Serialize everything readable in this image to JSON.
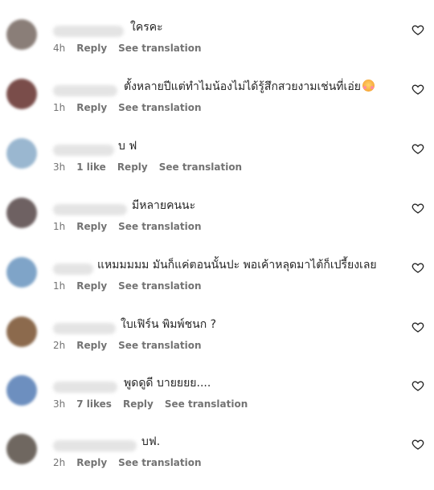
{
  "icons": {
    "like": "heart-outline-icon"
  },
  "comments": [
    {
      "text": "ใครคะ",
      "time": "4h",
      "likes": "",
      "reply": "Reply",
      "translate": "See translation",
      "avatar_color": "#8a7e78"
    },
    {
      "text": "ตั้งหลายปีแต่ทำไมน้องไม่ได้รู้สึกสวยงามเช่นที่เอ่ย",
      "emoji": "smiling-face-with-hearts",
      "time": "1h",
      "likes": "",
      "reply": "Reply",
      "translate": "See translation",
      "avatar_color": "#7a4d4a"
    },
    {
      "text": "บ ฟ",
      "time": "3h",
      "likes": "1 like",
      "reply": "Reply",
      "translate": "See translation",
      "avatar_color": "#9ab7d0"
    },
    {
      "text": "มีหลายคนนะ",
      "time": "1h",
      "likes": "",
      "reply": "Reply",
      "translate": "See translation",
      "avatar_color": "#6e6162"
    },
    {
      "text": "แหมมมมม มันก็แค่ตอนนั้นปะ พอเค้าหลุดมาไต้ก็เปรี้ยงเลย",
      "time": "1h",
      "likes": "",
      "reply": "Reply",
      "translate": "See translation",
      "avatar_color": "#7fa4c8"
    },
    {
      "text": "ใบเฟิร์น พิมพ์ชนก ?",
      "time": "2h",
      "likes": "",
      "reply": "Reply",
      "translate": "See translation",
      "avatar_color": "#8c6a4d"
    },
    {
      "text": "พูดดูดี บายยยย....",
      "time": "3h",
      "likes": "7 likes",
      "reply": "Reply",
      "translate": "See translation",
      "avatar_color": "#6d8fbf"
    },
    {
      "text": "บฟ.",
      "time": "2h",
      "likes": "",
      "reply": "Reply",
      "translate": "See translation",
      "avatar_color": "#6f6760"
    }
  ]
}
